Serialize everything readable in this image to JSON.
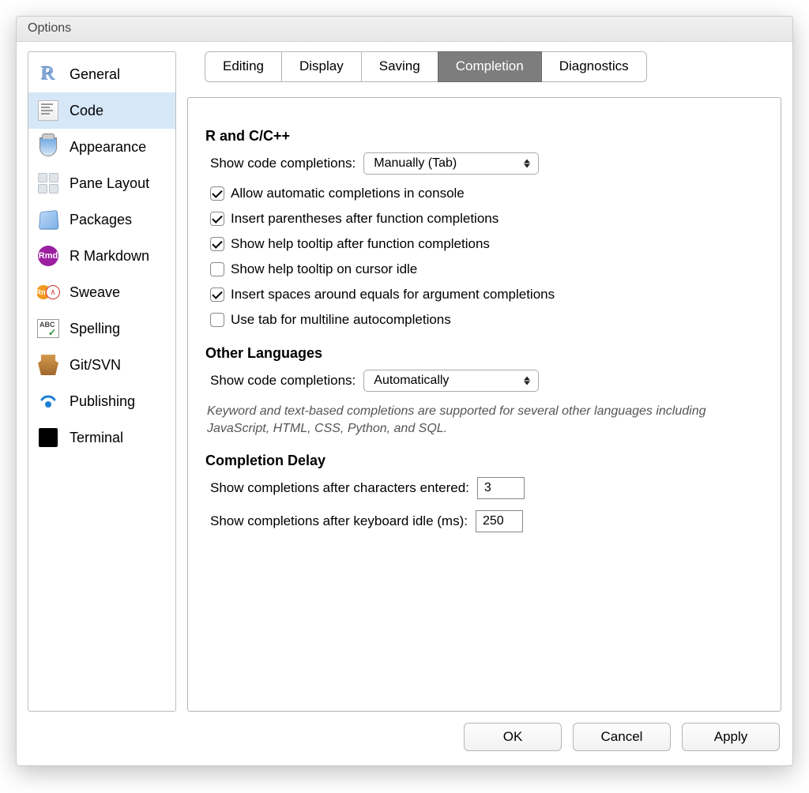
{
  "window": {
    "title": "Options"
  },
  "sidebar": {
    "items": [
      {
        "label": "General"
      },
      {
        "label": "Code"
      },
      {
        "label": "Appearance"
      },
      {
        "label": "Pane Layout"
      },
      {
        "label": "Packages"
      },
      {
        "label": "R Markdown"
      },
      {
        "label": "Sweave"
      },
      {
        "label": "Spelling"
      },
      {
        "label": "Git/SVN"
      },
      {
        "label": "Publishing"
      },
      {
        "label": "Terminal"
      }
    ],
    "selected_index": 1
  },
  "tabs": {
    "items": [
      "Editing",
      "Display",
      "Saving",
      "Completion",
      "Diagnostics"
    ],
    "selected_index": 3
  },
  "content": {
    "section1_title": "R and C/C++",
    "show_completions_label": "Show code completions:",
    "show_completions_value": "Manually (Tab)",
    "checks": [
      {
        "label": "Allow automatic completions in console",
        "checked": true
      },
      {
        "label": "Insert parentheses after function completions",
        "checked": true
      },
      {
        "label": "Show help tooltip after function completions",
        "checked": true
      },
      {
        "label": "Show help tooltip on cursor idle",
        "checked": false
      },
      {
        "label": "Insert spaces around equals for argument completions",
        "checked": true
      },
      {
        "label": "Use tab for multiline autocompletions",
        "checked": false
      }
    ],
    "section2_title": "Other Languages",
    "other_show_completions_value": "Automatically",
    "other_note": "Keyword and text-based completions are supported for several other languages including JavaScript, HTML, CSS, Python, and SQL.",
    "section3_title": "Completion Delay",
    "delay_chars_label": "Show completions after characters entered:",
    "delay_chars_value": "3",
    "delay_idle_label": "Show completions after keyboard idle (ms):",
    "delay_idle_value": "250"
  },
  "buttons": {
    "ok": "OK",
    "cancel": "Cancel",
    "apply": "Apply"
  },
  "rmd_icon_text": "Rmd",
  "sweave_icon_text": "Rnw",
  "spelling_icon_text": "ABC"
}
